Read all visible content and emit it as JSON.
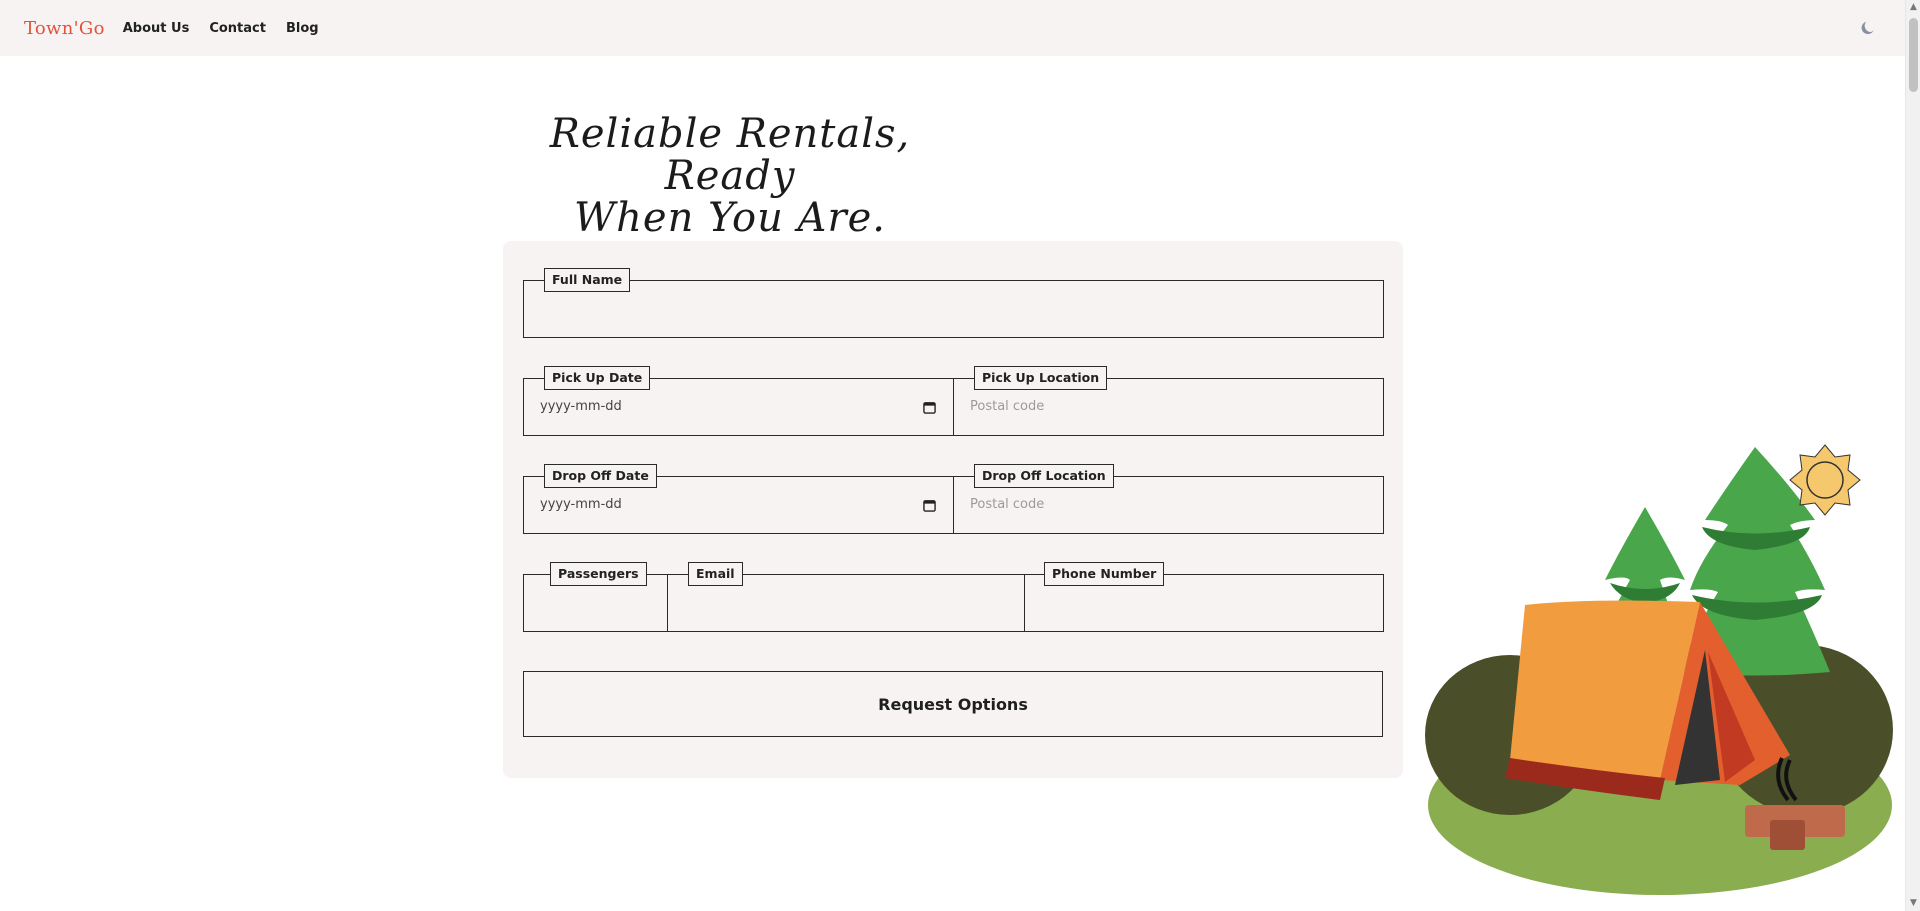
{
  "nav": {
    "logo": "Town'Go",
    "links": [
      "About Us",
      "Contact",
      "Blog"
    ],
    "theme_icon": "moon-icon"
  },
  "headline": {
    "line1": "Reliable Rentals, Ready",
    "line2": "When You Are."
  },
  "form": {
    "full_name_label": "Full Name",
    "pickup_date_label": "Pick Up Date",
    "pickup_location_label": "Pick Up Location",
    "dropoff_date_label": "Drop Off Date",
    "dropoff_location_label": "Drop Off Location",
    "passengers_label": "Passengers",
    "email_label": "Email",
    "phone_label": "Phone Number",
    "date_placeholder": "yyyy-mm-dd",
    "postal_placeholder": "Postal code",
    "submit_label": "Request Options"
  },
  "colors": {
    "brand": "#e4513c",
    "nav_bg": "#f7f3f2",
    "card_bg": "#f7f3f2",
    "tent_orange": "#f09c3f",
    "tent_red": "#e45f2e",
    "tree_green": "#4aa64b",
    "grass": "#8aad4f",
    "sun": "#f6c86d"
  }
}
